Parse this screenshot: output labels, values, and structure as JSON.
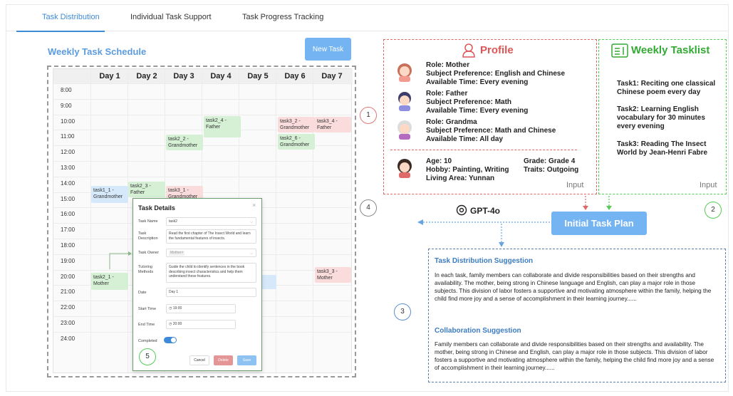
{
  "tabs": [
    {
      "label": "Task Distribution",
      "active": true
    },
    {
      "label": "Individual Task Support",
      "active": false
    },
    {
      "label": "Task Progress Tracking",
      "active": false
    }
  ],
  "schedule": {
    "title": "Weekly Task Schedule",
    "new_task_label": "New Task",
    "days": [
      "Day 1",
      "Day 2",
      "Day 3",
      "Day 4",
      "Day 5",
      "Day 6",
      "Day 7"
    ],
    "times": [
      "8:00",
      "9:00",
      "10:00",
      "11:00",
      "12:00",
      "13:00",
      "14:00",
      "15:00",
      "16:00",
      "17:00",
      "18:00",
      "19:00",
      "20:00",
      "21:00",
      "22:00",
      "23:00",
      "24:00"
    ],
    "tasks": {
      "t24": "task2_4 - Father",
      "t32": "task3_2 - Grandmother",
      "t34": "task3_4 - Father",
      "t22": "task2_2 - Grandmother",
      "t26": "task2_6 - Grandmother",
      "t23": "task2_3 - Father",
      "t11": "task1_1 - Grandmother",
      "t31": "task3_1 - Grandmother",
      "t21": "task2_1 - Mother",
      "t33": "task3_3 - Mother"
    }
  },
  "modal": {
    "title": "Task Details",
    "close": "×",
    "task_name_label": "Task Name",
    "task_name": "task2",
    "desc_label": "Task Description",
    "desc": "Read the first chapter of The Insect World and learn the fundamental features of insects.",
    "owner_label": "Task Owner",
    "owner": "Mother×",
    "methods_label": "Tutoring Methods",
    "methods": "Guide the child to identify sentences in the book describing insect characteristics and help them understand these features.",
    "date_label": "Date",
    "date": "Day 1",
    "start_label": "Start Time",
    "start": "19:00",
    "end_label": "End Time",
    "end": "20:00",
    "completed_label": "Completed",
    "cancel": "Cancel",
    "delete": "Delete",
    "save": "Save"
  },
  "badges": {
    "b1": "1",
    "b2": "2",
    "b3": "3",
    "b4": "4",
    "b5": "5"
  },
  "profile": {
    "title": "Profile",
    "mother": [
      "Role: Mother",
      "Subject Preference: English and Chinese",
      "Available Time: Every evening"
    ],
    "father": [
      "Role: Father",
      "Subject Preference: Math",
      "Available Time: Every evening"
    ],
    "grandma": [
      "Role: Grandma",
      "Subject Preference: Math and Chinese",
      "Available Time: All day"
    ],
    "child_left": [
      "Age: 10",
      "Hobby: Painting, Writing",
      "Living Area: Yunnan"
    ],
    "child_right": [
      "Grade: Grade 4",
      "Traits: Outgoing"
    ],
    "input_label": "Input"
  },
  "weekly": {
    "title": "Weekly Tasklist",
    "task1": "Task1: Reciting one classical Chinese poem every day",
    "task2": "Task2: Learning English vocabulary for 30 minutes every evening",
    "task3": "Task3: Reading The Insect World by Jean-Henri Fabre",
    "input_label": "Input"
  },
  "gpt_label": "GPT-4o",
  "initial_plan": "Initial Task Plan",
  "suggestions": {
    "dist_title": "Task Distribution Suggestion",
    "dist_body": "In each task, family members can collaborate and divide responsibilities based on their strengths and availability. The mother, being strong in Chinese language and English, can play a major role in those subjects. This division of labor fosters a supportive and motivating atmosphere within the family, helping the child find more joy and a sense of accomplishment in their learning journey......",
    "collab_title": "Collaboration Suggestion",
    "collab_body": "Family members can collaborate and divide responsibilities based on their strengths and availability. The mother, being strong in Chinese and English, can play a major role in those subjects. This division of labor fosters a supportive and motivating atmosphere within the family, helping the child find more joy and a sense of accomplishment in their learning journey......"
  },
  "colors": {
    "accent": "#3d8bd8",
    "button": "#74b4f2",
    "profile_red": "#d55",
    "weekly_green": "#3a3",
    "suggestion_blue": "#3c7cc0"
  }
}
